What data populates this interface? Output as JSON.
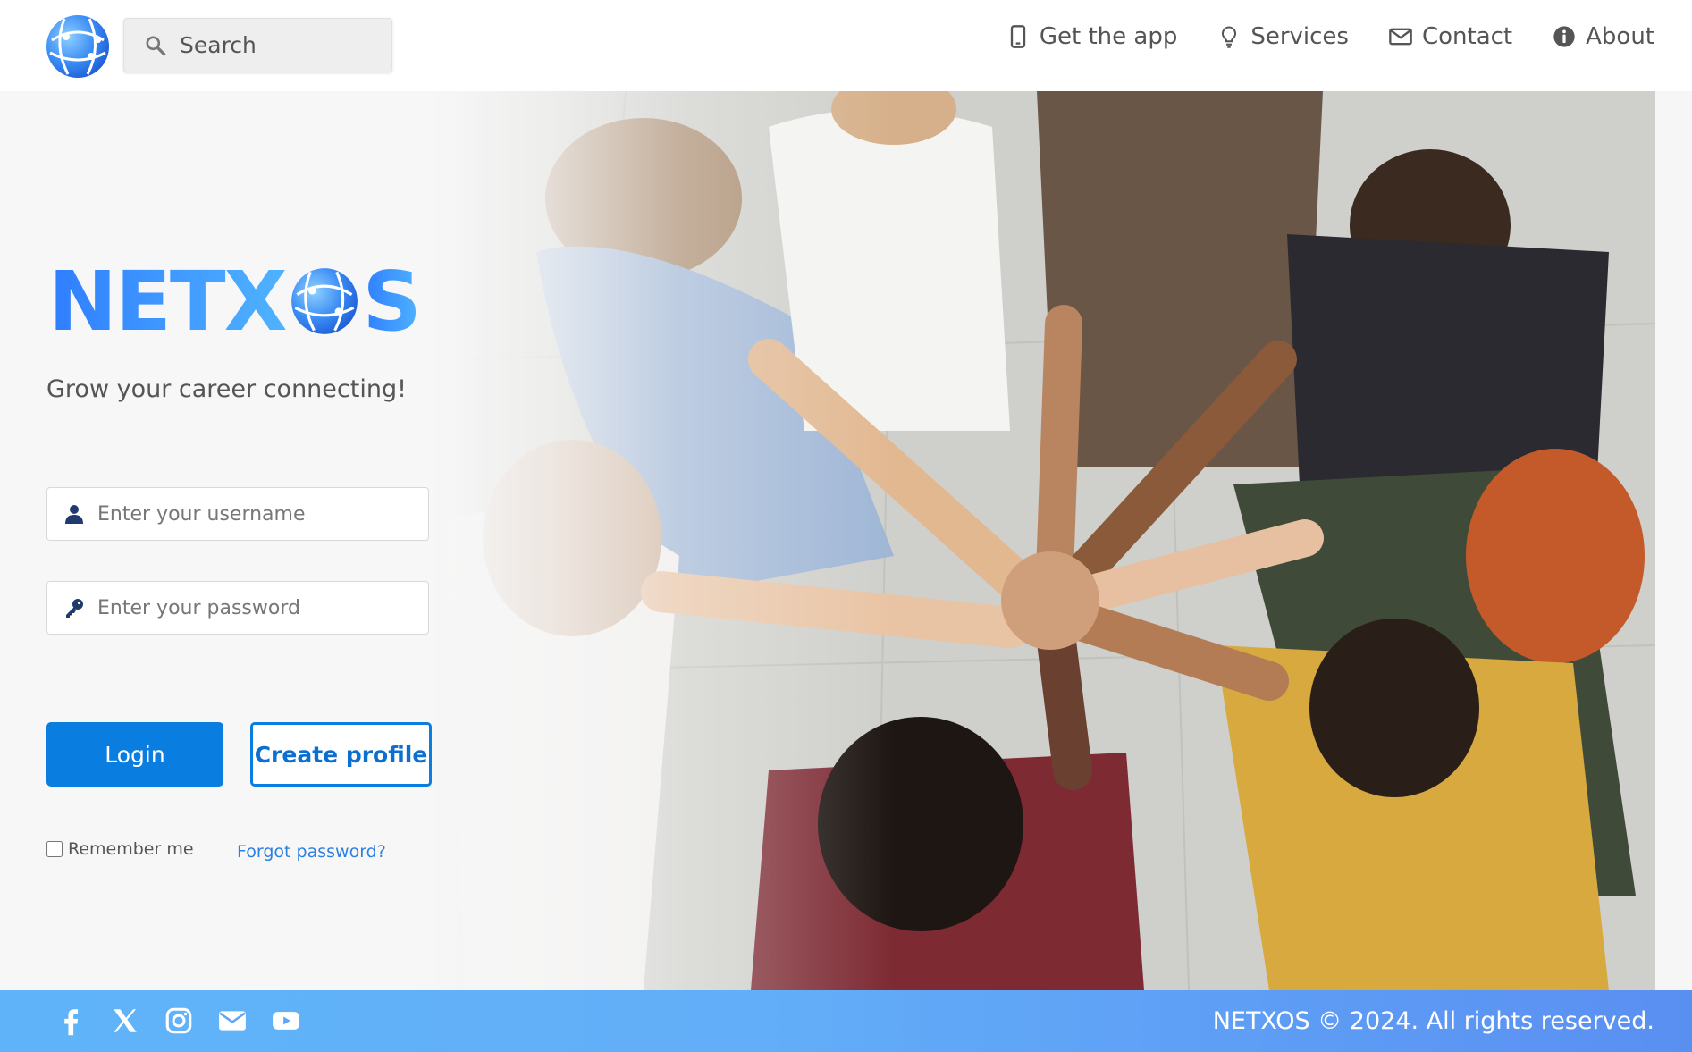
{
  "header": {
    "logo_icon": "globe-network-icon",
    "search": {
      "placeholder": "Search",
      "icon": "search-icon"
    },
    "nav": [
      {
        "label": "Get the app",
        "icon": "phone-icon"
      },
      {
        "label": "Services",
        "icon": "lightbulb-icon"
      },
      {
        "label": "Contact",
        "icon": "envelope-icon"
      },
      {
        "label": "About",
        "icon": "info-icon"
      }
    ]
  },
  "hero": {
    "brand": {
      "left": "NETX",
      "right": "S"
    },
    "tagline": "Grow your career connecting!",
    "photo": "group-hands-together-photo"
  },
  "login": {
    "username_placeholder": "Enter your username",
    "password_placeholder": "Enter your password",
    "login_label": "Login",
    "create_label": "Create profile",
    "remember_label": "Remember me",
    "remember_checked": false,
    "forgot_label": "Forgot password?"
  },
  "footer": {
    "social": [
      "facebook-icon",
      "x-twitter-icon",
      "instagram-icon",
      "email-icon",
      "youtube-icon"
    ],
    "copyright": "NETXOS © 2024. All rights reserved."
  },
  "colors": {
    "accent": "#0a7de0",
    "brand_gradient_start": "#2f7dff",
    "brand_gradient_end": "#4fb3ff",
    "footer_start": "#5fb4f9",
    "footer_end": "#5a8ff2",
    "nav_text": "#555555"
  }
}
